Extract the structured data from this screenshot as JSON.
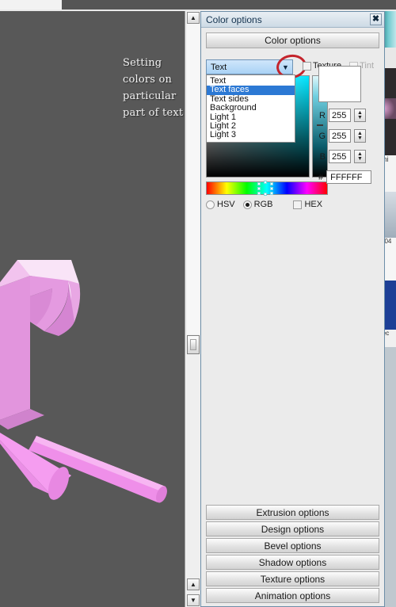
{
  "viewport": {
    "annotation": "Setting colors on particular part of text",
    "object_description": "3d-letter-r-pink",
    "background_color": "#585858",
    "object_color": "#ea86e0"
  },
  "panel": {
    "title": "Color options",
    "close_label": "✖",
    "header_button": "Color options",
    "combo": {
      "value": "Text",
      "arrow": "▼",
      "options": [
        {
          "label": "Text",
          "selected": false
        },
        {
          "label": "Text faces",
          "selected": true
        },
        {
          "label": "Text sides",
          "selected": false
        },
        {
          "label": "Background",
          "selected": false
        },
        {
          "label": "Light 1",
          "selected": false
        },
        {
          "label": "Light 2",
          "selected": false
        },
        {
          "label": "Light 3",
          "selected": false
        }
      ]
    },
    "checkboxes": [
      {
        "label": "Texture",
        "checked": false,
        "disabled": false
      },
      {
        "label": "Tint",
        "checked": false,
        "disabled": true
      }
    ],
    "color_model": {
      "modes": [
        {
          "label": "HSV",
          "selected": false
        },
        {
          "label": "RGB",
          "selected": true
        }
      ],
      "hex_toggle": {
        "label": "HEX",
        "checked": false
      }
    },
    "channels": [
      {
        "label": "R",
        "value": "255"
      },
      {
        "label": "G",
        "value": "255"
      },
      {
        "label": "B",
        "value": "255"
      }
    ],
    "hex": {
      "label": "#",
      "value": "FFFFFF"
    },
    "preview_color": "#FFFFFF",
    "spinner_up": "▲",
    "spinner_down": "▼",
    "bottom_buttons": [
      "Extrusion options",
      "Design options",
      "Bevel options",
      "Shadow options",
      "Texture options",
      "Animation options"
    ]
  },
  "scrollbar": {
    "up_arrow": "▲",
    "down_arrow": "▼"
  }
}
